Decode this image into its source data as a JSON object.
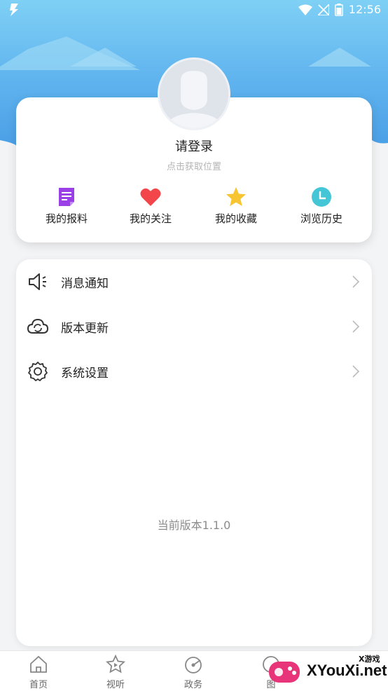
{
  "status_bar": {
    "time": "12:56",
    "logo_icon": "app-bolt-icon",
    "icons": [
      "wifi-icon",
      "no-signal-icon",
      "battery-icon"
    ]
  },
  "profile": {
    "login_prompt": "请登录",
    "location_prompt": "点击获取位置",
    "avatar_icon": "default-avatar-icon"
  },
  "quick_actions": [
    {
      "label": "我的报料",
      "icon": "report-document-icon",
      "color": "#9b3fe6"
    },
    {
      "label": "我的关注",
      "icon": "heart-icon",
      "color": "#f2464a"
    },
    {
      "label": "我的收藏",
      "icon": "star-icon",
      "color": "#f6c531"
    },
    {
      "label": "浏览历史",
      "icon": "clock-icon",
      "color": "#44c6d6"
    }
  ],
  "menu": [
    {
      "label": "消息通知",
      "icon": "speaker-icon"
    },
    {
      "label": "版本更新",
      "icon": "cloud-sync-icon"
    },
    {
      "label": "系统设置",
      "icon": "gear-icon"
    }
  ],
  "version_text": "当前版本1.1.0",
  "tabs": [
    {
      "label": "首页",
      "icon": "home-icon"
    },
    {
      "label": "视听",
      "icon": "video-star-icon"
    },
    {
      "label": "政务",
      "icon": "government-icon"
    },
    {
      "label": "图",
      "icon": "image-icon"
    }
  ],
  "watermark": {
    "text": "XYouXi.net",
    "small": "X游戏"
  }
}
